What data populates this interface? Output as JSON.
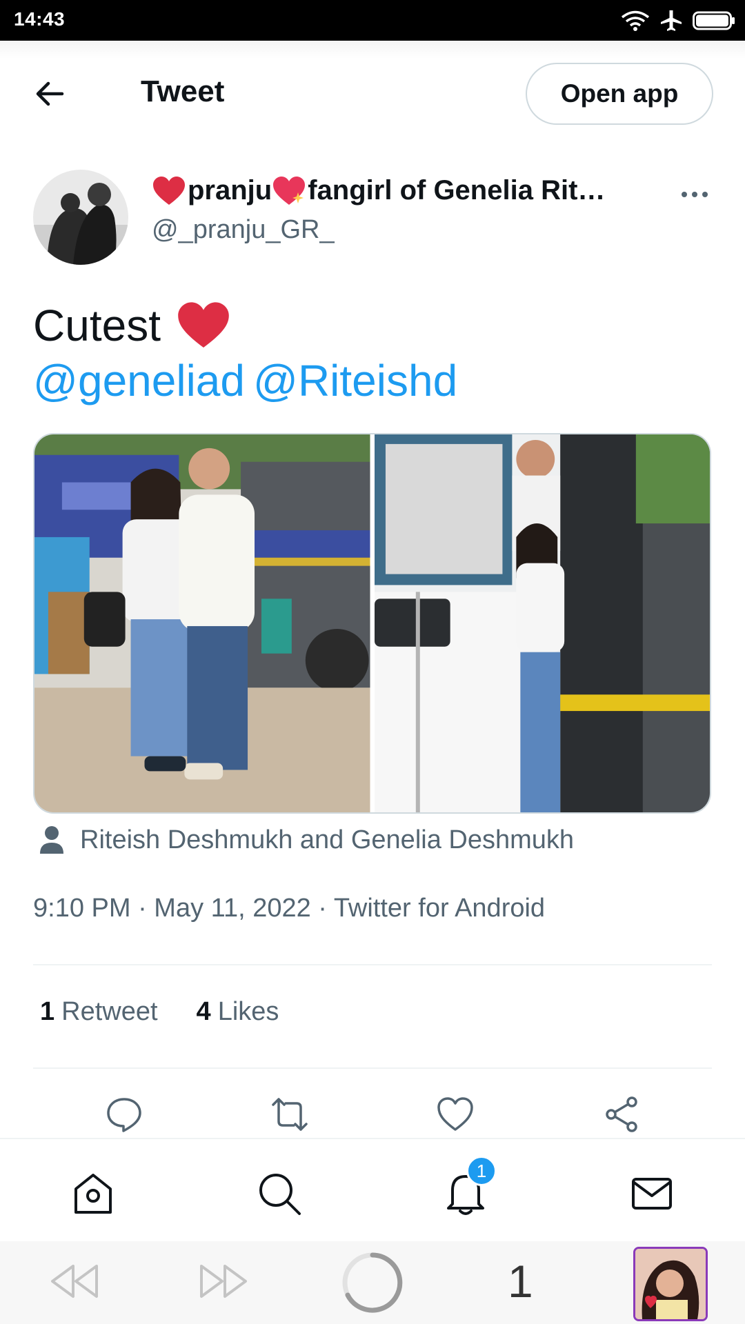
{
  "status_bar": {
    "time": "14:43"
  },
  "header": {
    "title": "Tweet",
    "open_app_label": "Open app"
  },
  "author": {
    "name_part1": "pranju",
    "name_part2": "fangirl of Genelia Rit…",
    "handle": "@_pranju_GR_"
  },
  "tweet": {
    "text": "Cutest",
    "mentions": [
      "@geneliad",
      "@Riteishd"
    ],
    "tagged_people": "Riteish Deshmukh and Genelia Deshmukh",
    "meta": "9:10 PM · May 11, 2022 · Twitter for Android"
  },
  "stats": {
    "retweets_count": "1",
    "retweets_label": "Retweet",
    "likes_count": "4",
    "likes_label": "Likes"
  },
  "tab_bar": {
    "notifications_badge": "1"
  },
  "browser_nav": {
    "page_count": "1"
  },
  "colors": {
    "accent": "#1d9bf0",
    "heart": "#e0245e",
    "secondary_text": "#536471"
  }
}
